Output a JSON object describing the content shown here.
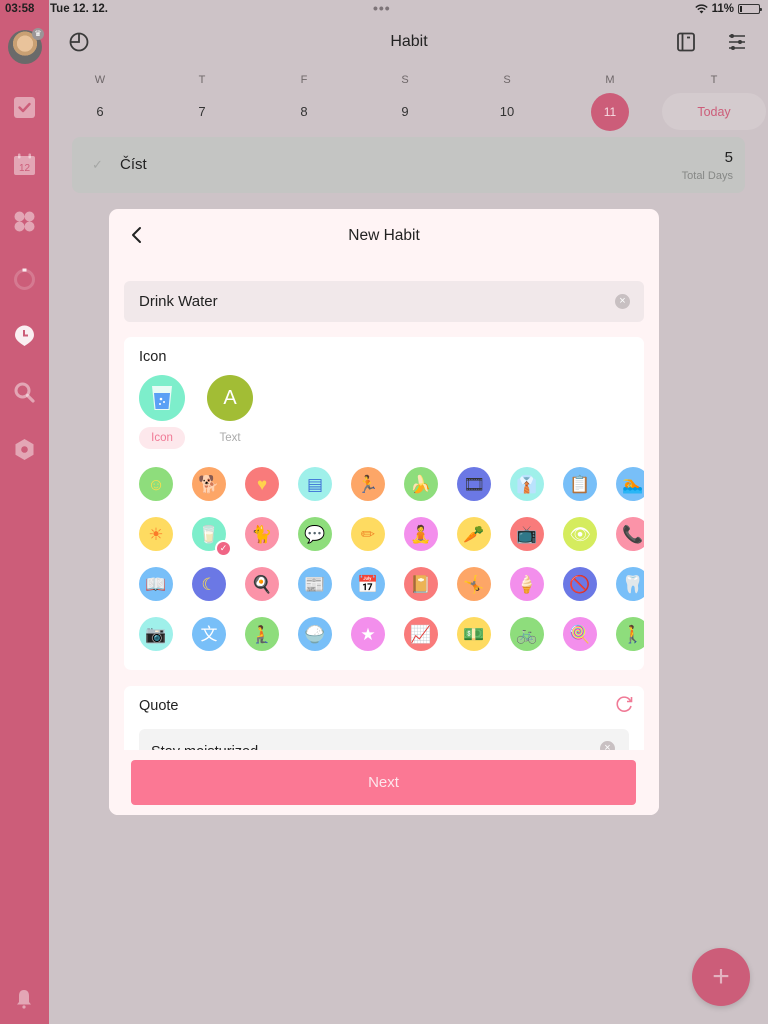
{
  "status_bar": {
    "time": "03:58",
    "date": "Tue 12. 12.",
    "battery": "11%"
  },
  "header": {
    "title": "Habit"
  },
  "sidebar": {
    "items": [
      {
        "name": "tasks",
        "icon": "checkbox-icon"
      },
      {
        "name": "calendar",
        "icon": "calendar-icon",
        "label": "12"
      },
      {
        "name": "matrix",
        "icon": "four-leaf-icon"
      },
      {
        "name": "pomodoro",
        "icon": "ring-timer-icon"
      },
      {
        "name": "habit",
        "icon": "clock-pin-icon",
        "active": true
      },
      {
        "name": "search",
        "icon": "search-icon"
      },
      {
        "name": "settings",
        "icon": "hexagon-icon"
      }
    ]
  },
  "week": {
    "days": [
      {
        "weekday": "W",
        "date": "6"
      },
      {
        "weekday": "T",
        "date": "7"
      },
      {
        "weekday": "F",
        "date": "8"
      },
      {
        "weekday": "S",
        "date": "9"
      },
      {
        "weekday": "S",
        "date": "10"
      },
      {
        "weekday": "M",
        "date": "11",
        "selected": true
      },
      {
        "weekday": "T",
        "date": "Today"
      }
    ]
  },
  "habit_card": {
    "name": "Číst",
    "count": "5",
    "count_label": "Total Days"
  },
  "modal": {
    "title": "New Habit",
    "name_value": "Drink Water",
    "icon_section": {
      "label": "Icon",
      "mode_icon_label": "Icon",
      "mode_text_label": "Text",
      "mode_text_letter": "A",
      "selected_icon": "drink-water"
    },
    "icons": [
      {
        "name": "smile",
        "glyph": "☺",
        "bg": "#8edd7c",
        "fg": "#ffe04a"
      },
      {
        "name": "dog-walk",
        "glyph": "🐕",
        "bg": "#fda667",
        "fg": "#fff"
      },
      {
        "name": "heart-hand",
        "glyph": "♥",
        "bg": "#f97b7b",
        "fg": "#ffd34d"
      },
      {
        "name": "book",
        "glyph": "▤",
        "bg": "#9ff0ea",
        "fg": "#3b6fd6"
      },
      {
        "name": "run",
        "glyph": "🏃",
        "bg": "#fda667",
        "fg": "#fff"
      },
      {
        "name": "banana",
        "glyph": "🍌",
        "bg": "#8edd7c",
        "fg": "#ffe04a"
      },
      {
        "name": "film",
        "glyph": "🎞",
        "bg": "#6b78e5",
        "fg": "#333"
      },
      {
        "name": "suit",
        "glyph": "👔",
        "bg": "#9ff0ea",
        "fg": "#333"
      },
      {
        "name": "clipboard",
        "glyph": "📋",
        "bg": "#78bff8",
        "fg": "#fff"
      },
      {
        "name": "swim",
        "glyph": "🏊",
        "bg": "#78bff8",
        "fg": "#fff"
      },
      {
        "name": "sun",
        "glyph": "☀",
        "bg": "#fedb61",
        "fg": "#fb7b2a"
      },
      {
        "name": "drink-water",
        "glyph": "🥛",
        "bg": "#7deecb",
        "fg": "#5aa0f5",
        "selected": true
      },
      {
        "name": "cat",
        "glyph": "🐈",
        "bg": "#fb93a8",
        "fg": "#fff"
      },
      {
        "name": "chat",
        "glyph": "💬",
        "bg": "#8edd7c",
        "fg": "#fff"
      },
      {
        "name": "pencil",
        "glyph": "✏",
        "bg": "#fedb61",
        "fg": "#f08a2a"
      },
      {
        "name": "yoga",
        "glyph": "🧘",
        "bg": "#f38fec",
        "fg": "#fff"
      },
      {
        "name": "carrot",
        "glyph": "🥕",
        "bg": "#fedb61",
        "fg": "#f0802a"
      },
      {
        "name": "tv",
        "glyph": "📺",
        "bg": "#f97b7b",
        "fg": "#ffd34d"
      },
      {
        "name": "eye",
        "glyph": "👁",
        "bg": "#d5ec5e",
        "fg": "#fff"
      },
      {
        "name": "phone-heart",
        "glyph": "📞",
        "bg": "#fb93a8",
        "fg": "#8a3cf0"
      },
      {
        "name": "reading",
        "glyph": "📖",
        "bg": "#78bff8",
        "fg": "#fff"
      },
      {
        "name": "sleep",
        "glyph": "☾",
        "bg": "#6b78e5",
        "fg": "#ffe04a"
      },
      {
        "name": "breakfast",
        "glyph": "🍳",
        "bg": "#fb93a8",
        "fg": "#fff"
      },
      {
        "name": "news",
        "glyph": "📰",
        "bg": "#78bff8",
        "fg": "#fff"
      },
      {
        "name": "calendar-check",
        "glyph": "📅",
        "bg": "#78bff8",
        "fg": "#fff"
      },
      {
        "name": "diary",
        "glyph": "📔",
        "bg": "#f97b7b",
        "fg": "#ffd34d"
      },
      {
        "name": "push-up",
        "glyph": "🤸",
        "bg": "#fda667",
        "fg": "#fff"
      },
      {
        "name": "no-ice-cream",
        "glyph": "🍦",
        "bg": "#f38fec",
        "fg": "#fff"
      },
      {
        "name": "no-junk-food",
        "glyph": "🚫",
        "bg": "#6b78e5",
        "fg": "#ffe04a"
      },
      {
        "name": "tooth",
        "glyph": "🦷",
        "bg": "#78bff8",
        "fg": "#fff"
      },
      {
        "name": "camera",
        "glyph": "📷",
        "bg": "#9ff0ea",
        "fg": "#333"
      },
      {
        "name": "translate",
        "glyph": "文",
        "bg": "#78bff8",
        "fg": "#fff"
      },
      {
        "name": "stretch",
        "glyph": "🧎",
        "bg": "#8edd7c",
        "fg": "#fff"
      },
      {
        "name": "rice-bowl",
        "glyph": "🍚",
        "bg": "#78bff8",
        "fg": "#fff"
      },
      {
        "name": "star-video",
        "glyph": "★",
        "bg": "#f38fec",
        "fg": "#fff"
      },
      {
        "name": "growth",
        "glyph": "📈",
        "bg": "#f97b7b",
        "fg": "#ffd34d"
      },
      {
        "name": "money",
        "glyph": "💵",
        "bg": "#fedb61",
        "fg": "#3aa04a"
      },
      {
        "name": "cycling",
        "glyph": "🚲",
        "bg": "#8edd7c",
        "fg": "#fff"
      },
      {
        "name": "no-candy",
        "glyph": "🍭",
        "bg": "#f38fec",
        "fg": "#fff"
      },
      {
        "name": "walk",
        "glyph": "🚶",
        "bg": "#8edd7c",
        "fg": "#fff"
      }
    ],
    "quote_section": {
      "label": "Quote",
      "value": "Stay moisturized"
    },
    "next_label": "Next"
  },
  "colors": {
    "accent": "#fb7894",
    "sidebar": "#cc5d79",
    "modal_bg": "#fff4f5"
  }
}
